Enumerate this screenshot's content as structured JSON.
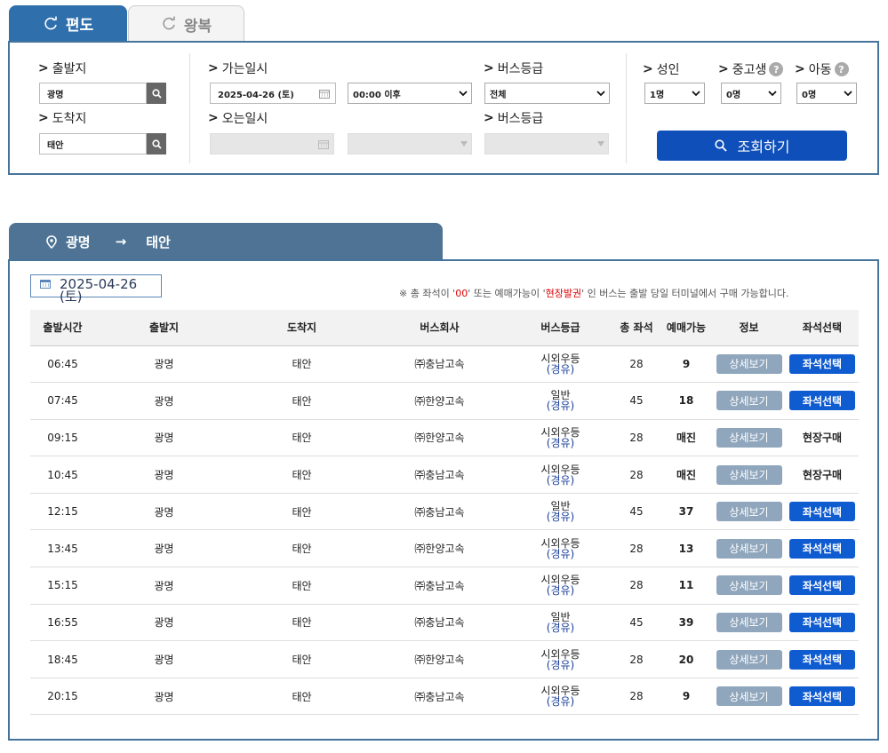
{
  "tabs": {
    "oneway": "편도",
    "roundtrip": "왕복"
  },
  "search": {
    "departure_label": "출발지",
    "departure_value": "광명",
    "arrival_label": "도착지",
    "arrival_value": "태안",
    "go_date_label": "가는일시",
    "go_date_value": "2025-04-26 (토)",
    "go_time_value": "00:00 이후",
    "bus_grade_label": "버스등급",
    "bus_grade_value": "전체",
    "return_date_label": "오는일시",
    "return_grade_label": "버스등급",
    "adult_label": "성인",
    "adult_value": "1명",
    "student_label": "중고생",
    "child_label": "아동",
    "student_value": "0명",
    "child_value": "0명",
    "help_glyph": "?",
    "search_button": "조회하기"
  },
  "route": {
    "from": "광명",
    "arrow": "→",
    "to": "태안"
  },
  "results": {
    "date": "2025-04-26 (토)",
    "notice_prefix": "※ 총 좌석이 '",
    "notice_00": "00",
    "notice_mid": "' 또는 예매가능이 '",
    "notice_onsite": "현장발권",
    "notice_suffix": "' 인 버스는 출발 당일 터미널에서 구매 가능합니다.",
    "headers": [
      "출발시간",
      "출발지",
      "도착지",
      "버스회사",
      "버스등급",
      "총 좌석",
      "예매가능",
      "정보",
      "좌석선택"
    ],
    "detail_label": "상세보기",
    "seat_label": "좌석선택",
    "onsite_label": "현장구매",
    "rows": [
      {
        "time": "06:45",
        "from": "광명",
        "to": "태안",
        "company": "㈜충남고속",
        "grade": "시외우등",
        "grade_sub": "(경유)",
        "total": "28",
        "avail": "9",
        "action": "seat"
      },
      {
        "time": "07:45",
        "from": "광명",
        "to": "태안",
        "company": "㈜한양고속",
        "grade": "일반",
        "grade_sub": "(경유)",
        "total": "45",
        "avail": "18",
        "action": "seat"
      },
      {
        "time": "09:15",
        "from": "광명",
        "to": "태안",
        "company": "㈜한양고속",
        "grade": "시외우등",
        "grade_sub": "(경유)",
        "total": "28",
        "avail": "매진",
        "action": "onsite"
      },
      {
        "time": "10:45",
        "from": "광명",
        "to": "태안",
        "company": "㈜충남고속",
        "grade": "시외우등",
        "grade_sub": "(경유)",
        "total": "28",
        "avail": "매진",
        "action": "onsite"
      },
      {
        "time": "12:15",
        "from": "광명",
        "to": "태안",
        "company": "㈜충남고속",
        "grade": "일반",
        "grade_sub": "(경유)",
        "total": "45",
        "avail": "37",
        "action": "seat"
      },
      {
        "time": "13:45",
        "from": "광명",
        "to": "태안",
        "company": "㈜한양고속",
        "grade": "시외우등",
        "grade_sub": "(경유)",
        "total": "28",
        "avail": "13",
        "action": "seat"
      },
      {
        "time": "15:15",
        "from": "광명",
        "to": "태안",
        "company": "㈜충남고속",
        "grade": "시외우등",
        "grade_sub": "(경유)",
        "total": "28",
        "avail": "11",
        "action": "seat"
      },
      {
        "time": "16:55",
        "from": "광명",
        "to": "태안",
        "company": "㈜충남고속",
        "grade": "일반",
        "grade_sub": "(경유)",
        "total": "45",
        "avail": "39",
        "action": "seat"
      },
      {
        "time": "18:45",
        "from": "광명",
        "to": "태안",
        "company": "㈜한양고속",
        "grade": "시외우등",
        "grade_sub": "(경유)",
        "total": "28",
        "avail": "20",
        "action": "seat"
      },
      {
        "time": "20:15",
        "from": "광명",
        "to": "태안",
        "company": "㈜충남고속",
        "grade": "시외우등",
        "grade_sub": "(경유)",
        "total": "28",
        "avail": "9",
        "action": "seat"
      }
    ]
  }
}
